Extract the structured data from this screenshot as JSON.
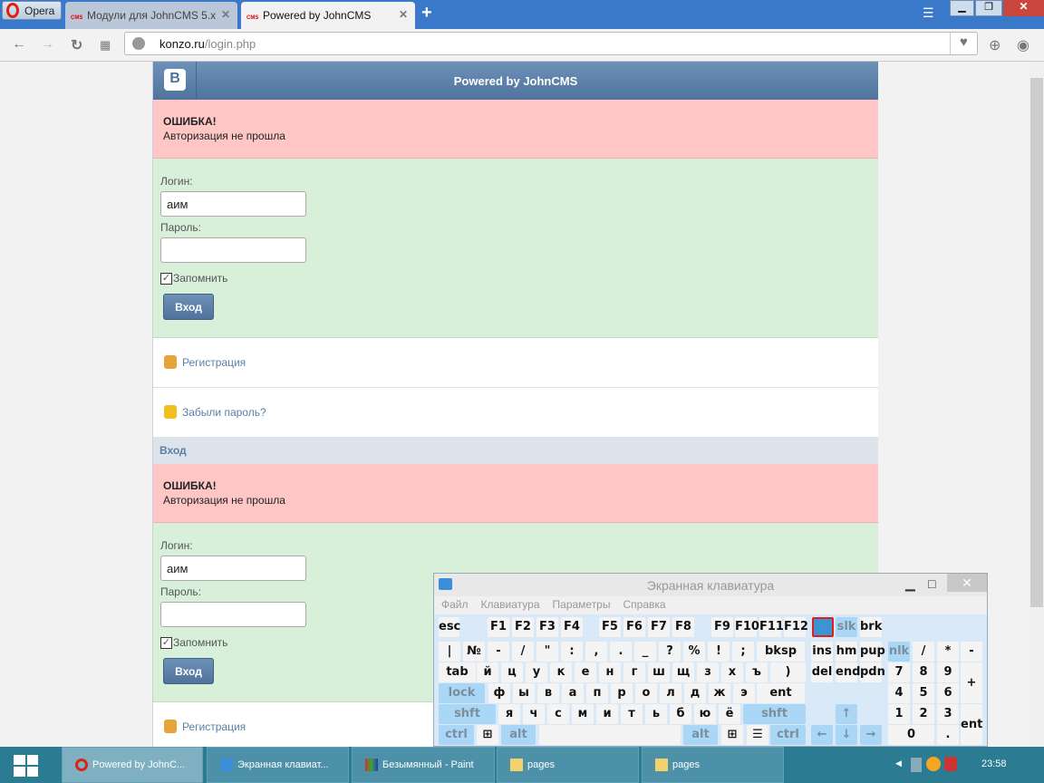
{
  "browser": {
    "opera_label": "Opera",
    "tabs": [
      {
        "label": "Модули для JohnCMS 5.x",
        "active": false
      },
      {
        "label": "Powered by JohnCMS",
        "active": true
      }
    ],
    "fav_text": "CMS",
    "new_tab": "+",
    "url_host": "konzo.ru",
    "url_path": "/login.php"
  },
  "page": {
    "header_title": "Powered by JohnCMS",
    "logo": "B",
    "error_title": "ОШИБКА!",
    "error_text": "Авторизация не прошла",
    "login_label": "Логин:",
    "login_value": "аим",
    "password_label": "Пароль:",
    "remember_label": "Запомнить",
    "remember_checked": true,
    "submit_label": "Вход",
    "register_link": "Регистрация",
    "forgot_link": "Забыли пароль?",
    "section_title": "Вход"
  },
  "osk": {
    "title": "Экранная клавиатура",
    "menu": [
      "Файл",
      "Клавиатура",
      "Параметры",
      "Справка"
    ],
    "keys": [
      "esc",
      "F1",
      "F2",
      "F3",
      "F4",
      "F5",
      "F6",
      "F7",
      "F8",
      "F9",
      "F10",
      "F11",
      "F12",
      "",
      "slk",
      "brk",
      "|",
      "№",
      "-",
      "/",
      "\"",
      ":",
      ",",
      ".",
      "_",
      "?",
      "%",
      "!",
      ";",
      "bksp",
      "ins",
      "hm",
      "pup",
      "nlk",
      "/",
      "*",
      "-",
      "tab",
      "й",
      "ц",
      "у",
      "к",
      "е",
      "н",
      "г",
      "ш",
      "щ",
      "з",
      "х",
      "ъ",
      ")",
      "del",
      "end",
      "pdn",
      "7",
      "8",
      "9",
      "+",
      "lock",
      "ф",
      "ы",
      "в",
      "а",
      "п",
      "р",
      "о",
      "л",
      "д",
      "ж",
      "э",
      "ent",
      "4",
      "5",
      "6",
      "shft",
      "я",
      "ч",
      "с",
      "м",
      "и",
      "т",
      "ь",
      "б",
      "ю",
      "ё",
      "shft",
      "↑",
      "1",
      "2",
      "3",
      "ent",
      "ctrl",
      "⊞",
      "alt",
      "",
      "alt",
      "⊞",
      "☰",
      "ctrl",
      "←",
      "↓",
      "→",
      "0",
      "."
    ]
  },
  "taskbar": {
    "items": [
      {
        "label": "Powered by JohnC...",
        "icon": "opera-icon"
      },
      {
        "label": "Экранная клавиат...",
        "icon": "keyboard-icon"
      },
      {
        "label": "Безымянный - Paint",
        "icon": "paint-icon"
      },
      {
        "label": "pages",
        "icon": "folder-icon"
      },
      {
        "label": "pages",
        "icon": "folder-icon"
      }
    ],
    "clock": "23:58"
  },
  "colors": {
    "accent": "#5b7fa6",
    "error_bg": "#ffc6c6",
    "form_bg": "#d8efd9",
    "taskbar": "#2b7b93"
  }
}
